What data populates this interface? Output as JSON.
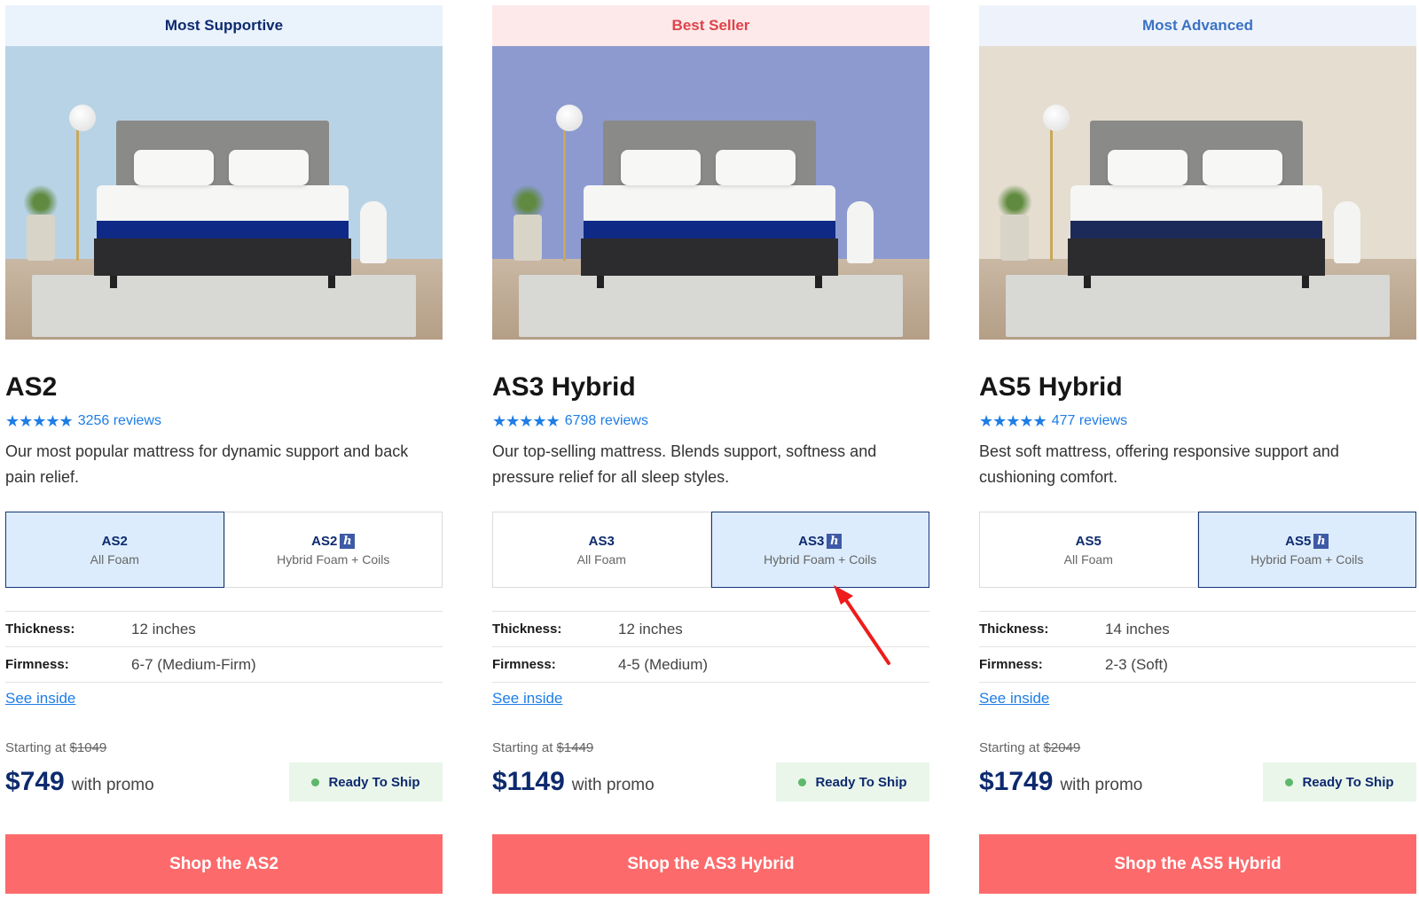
{
  "products": [
    {
      "badge": "Most Supportive",
      "name": "AS2",
      "stars": "★★★★★",
      "reviews": "3256 reviews",
      "description": "Our most popular mattress for dynamic support and back pain relief.",
      "variants": [
        {
          "name": "AS2",
          "sub": "All Foam",
          "hybrid": false,
          "active": true
        },
        {
          "name": "AS2",
          "sub": "Hybrid Foam + Coils",
          "hybrid": true,
          "active": false
        }
      ],
      "thickness_label": "Thickness:",
      "thickness": "12 inches",
      "firmness_label": "Firmness:",
      "firmness": "6-7 (Medium-Firm)",
      "see_inside": "See inside",
      "starting_label": "Starting at",
      "original_price": "$1049",
      "price": "$749",
      "promo": "with promo",
      "ship": "Ready To Ship",
      "cta": "Shop the AS2",
      "wall_color": "#b9d3e6",
      "band_color": "#0f2a86"
    },
    {
      "badge": "Best Seller",
      "name": "AS3 Hybrid",
      "stars": "★★★★★",
      "reviews": "6798 reviews",
      "description": "Our top-selling mattress. Blends support, softness and pressure relief for all sleep styles.",
      "variants": [
        {
          "name": "AS3",
          "sub": "All Foam",
          "hybrid": false,
          "active": false
        },
        {
          "name": "AS3",
          "sub": "Hybrid Foam + Coils",
          "hybrid": true,
          "active": true
        }
      ],
      "thickness_label": "Thickness:",
      "thickness": "12 inches",
      "firmness_label": "Firmness:",
      "firmness": "4-5 (Medium)",
      "see_inside": "See inside",
      "starting_label": "Starting at",
      "original_price": "$1449",
      "price": "$1149",
      "promo": "with promo",
      "ship": "Ready To Ship",
      "cta": "Shop the AS3 Hybrid",
      "wall_color": "#8c9ad0",
      "band_color": "#0f2a86"
    },
    {
      "badge": "Most Advanced",
      "name": "AS5 Hybrid",
      "stars": "★★★★★",
      "reviews": "477 reviews",
      "description": "Best soft mattress, offering responsive support and cushioning comfort.",
      "variants": [
        {
          "name": "AS5",
          "sub": "All Foam",
          "hybrid": false,
          "active": false
        },
        {
          "name": "AS5",
          "sub": "Hybrid Foam + Coils",
          "hybrid": true,
          "active": true
        }
      ],
      "thickness_label": "Thickness:",
      "thickness": "14 inches",
      "firmness_label": "Firmness:",
      "firmness": "2-3 (Soft)",
      "see_inside": "See inside",
      "starting_label": "Starting at",
      "original_price": "$2049",
      "price": "$1749",
      "promo": "with promo",
      "ship": "Ready To Ship",
      "cta": "Shop the AS5 Hybrid",
      "wall_color": "#e4ddd0",
      "band_color": "#1c2a5a"
    }
  ],
  "hybrid_mark": "h",
  "colors": {
    "accent": "#1e7de6",
    "navy": "#0d2a6e",
    "cta": "#fd6a6b",
    "annotation_arrow": "#ee1c1c"
  }
}
